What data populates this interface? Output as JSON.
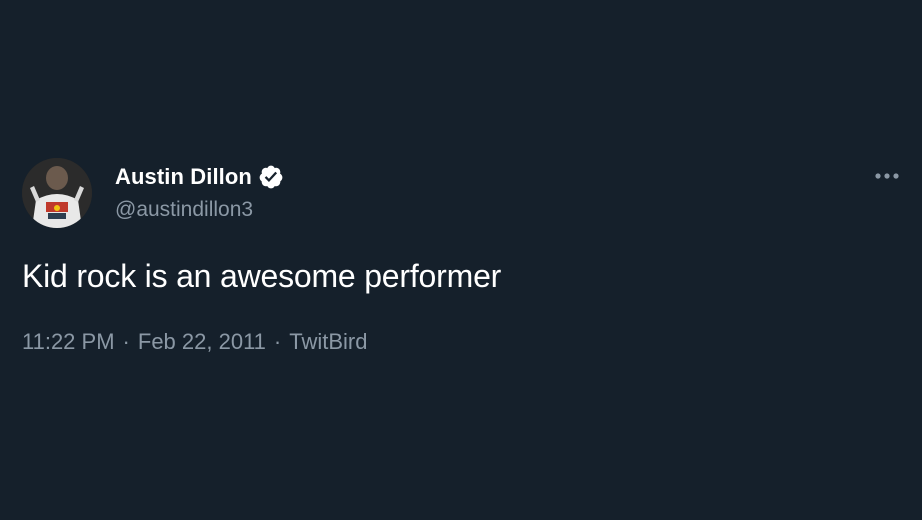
{
  "tweet": {
    "display_name": "Austin Dillon",
    "handle": "@austindillon3",
    "text": "Kid rock is an awesome performer",
    "time": "11:22 PM",
    "date": "Feb 22, 2011",
    "source": "TwitBird",
    "separator": "·",
    "verified": true
  },
  "icons": {
    "verified": "verified-badge-icon",
    "more": "more-options-icon"
  },
  "colors": {
    "background": "#15202b",
    "primary_text": "#ffffff",
    "secondary_text": "#8b98a5"
  }
}
